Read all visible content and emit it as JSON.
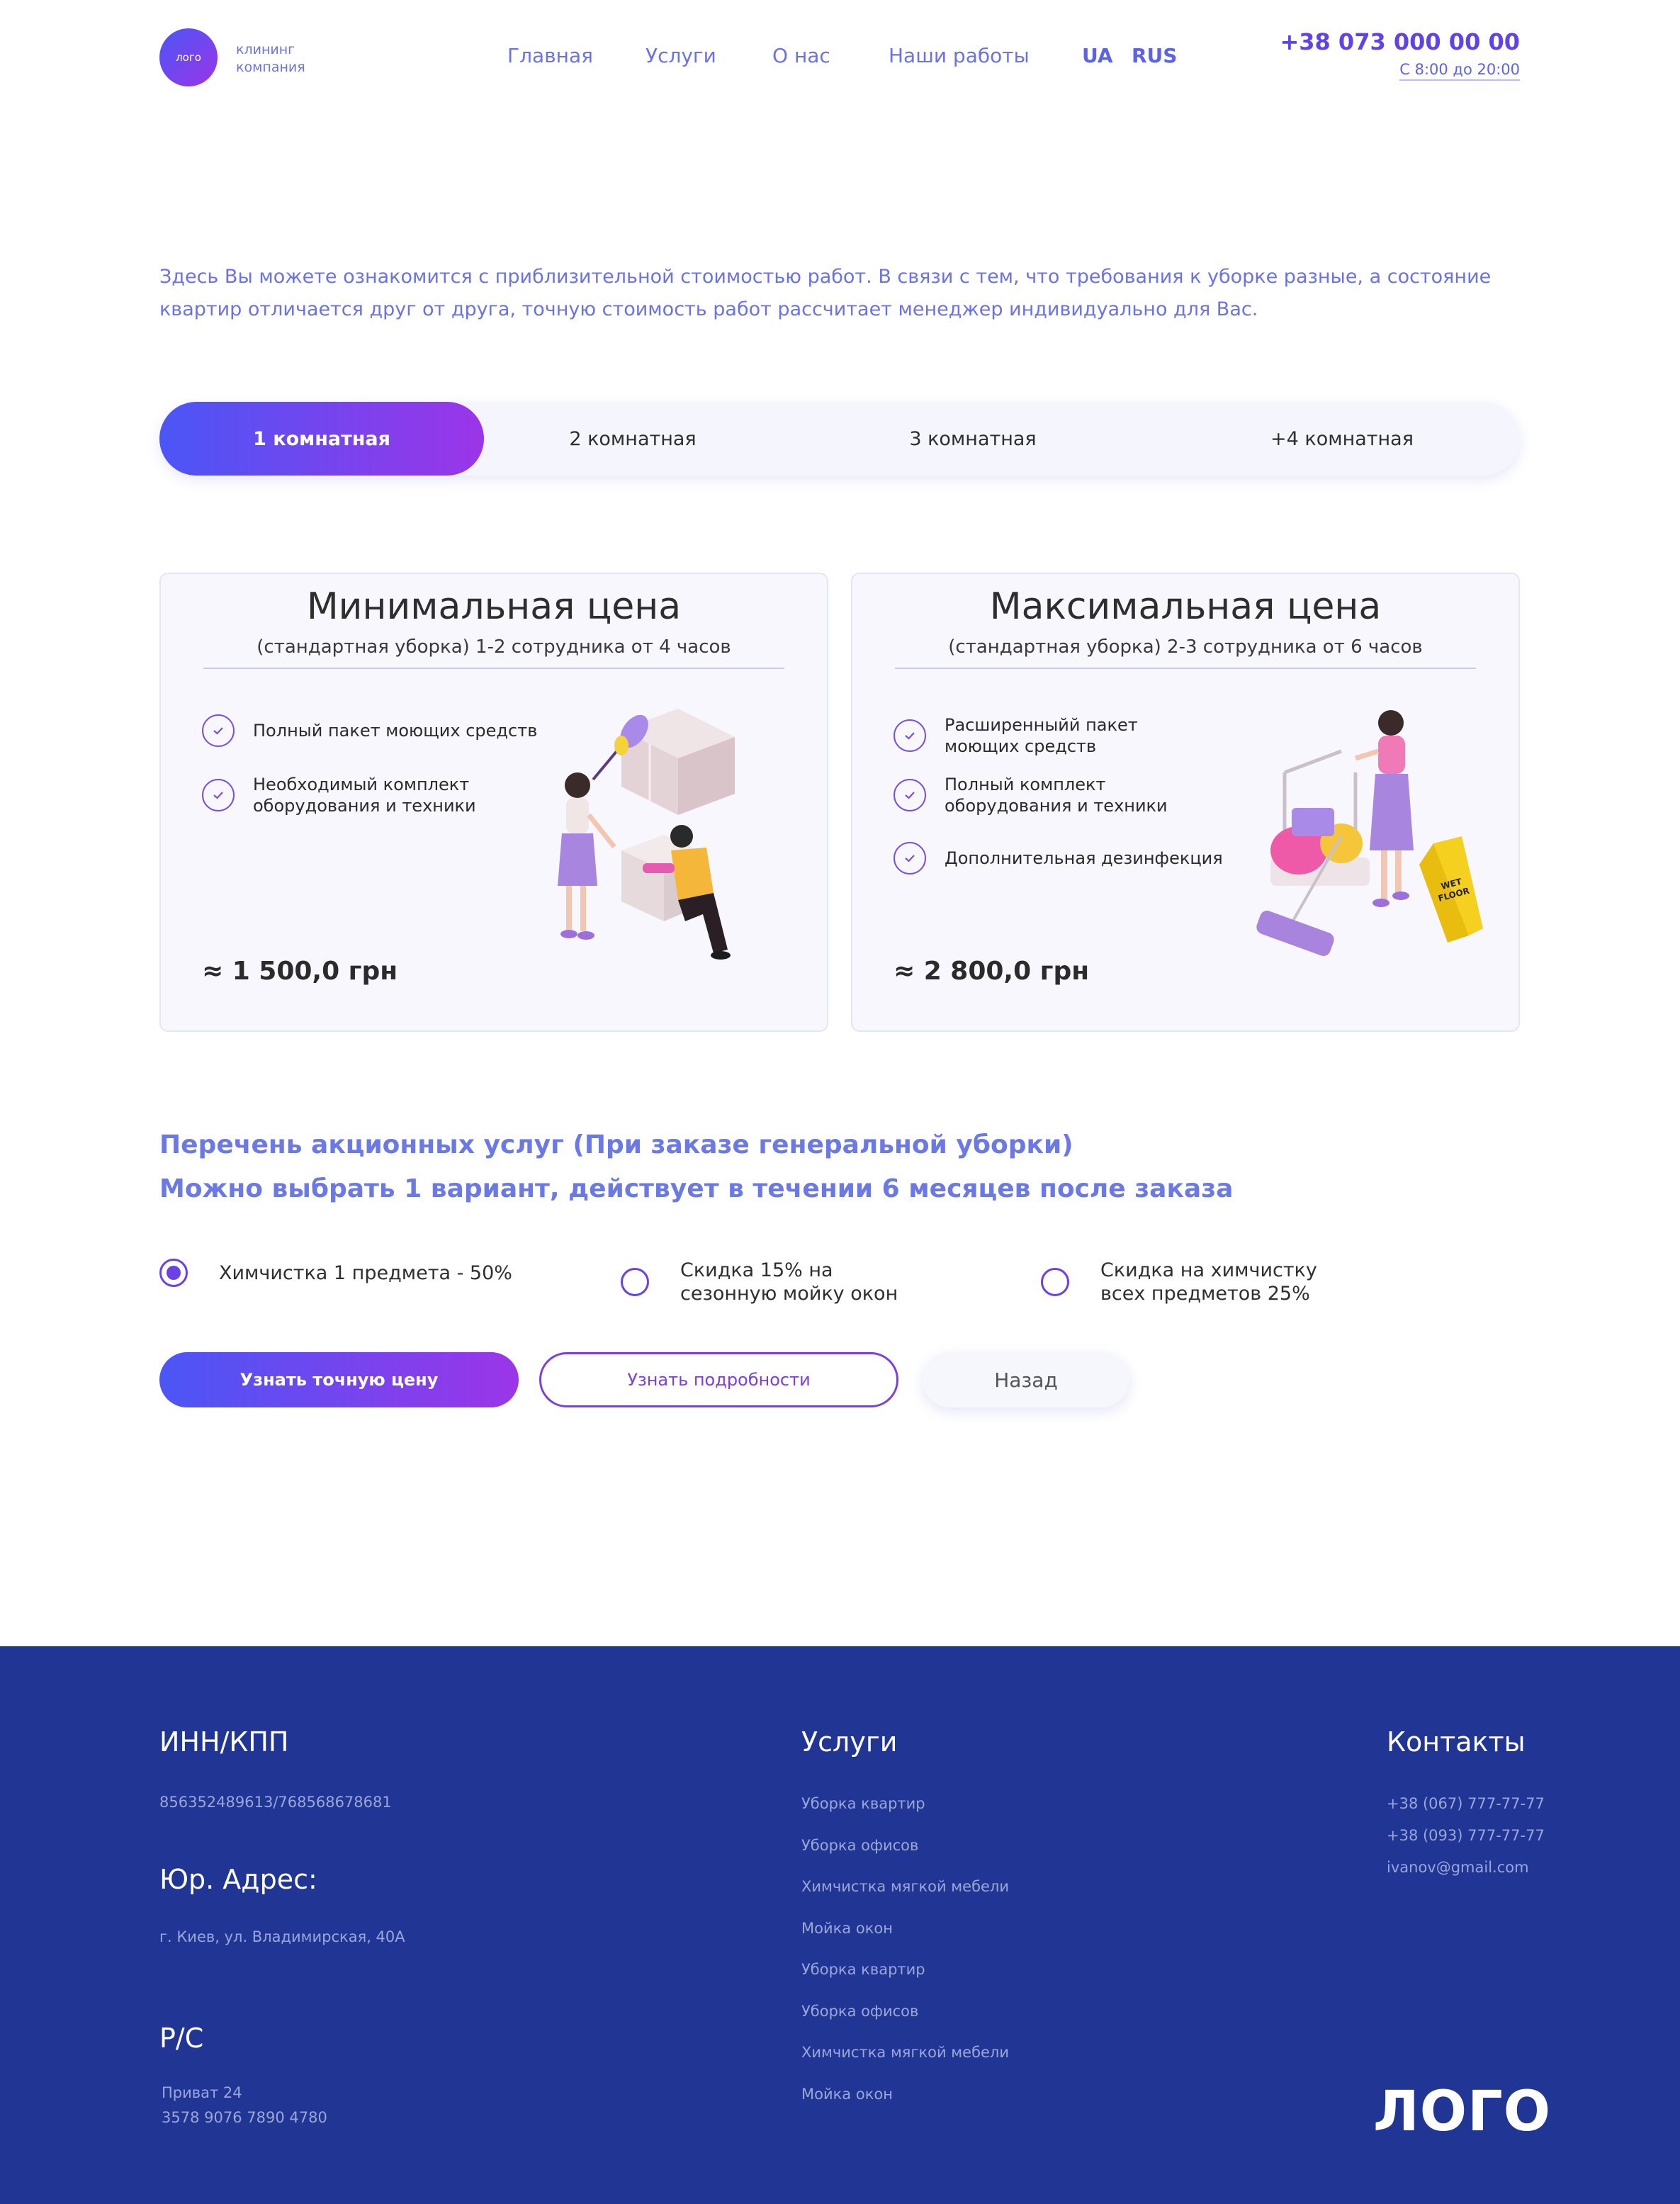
{
  "header": {
    "logo_mark": "лого",
    "logo_caption": "клининг\nкомпания",
    "nav": [
      "Главная",
      "Услуги",
      "О нас",
      "Наши работы"
    ],
    "languages": [
      "UA",
      "RUS"
    ],
    "phone": "+38 073 000 00 00",
    "hours": "С 8:00 до 20:00"
  },
  "intro": "Здесь Вы можете ознакомится с приблизительной стоимостью работ. В связи с тем, что требования к уборке разные, а состояние квартир отличается друг от друга, точную стоимость работ рассчитает менеджер индивидуально для Вас.",
  "tabs": {
    "items": [
      "1 комнатная",
      "2 комнатная",
      "3 комнатная",
      "+4 комнатная"
    ],
    "active_index": 0
  },
  "cards": [
    {
      "title": "Минимальная цена",
      "subtitle": "(стандартная уборка) 1-2 сотрудника от 4 часов",
      "features": [
        "Полный пакет моющих средств",
        "Необходимый комплект\nоборудования и техники"
      ],
      "price": "≈ 1 500,0 грн"
    },
    {
      "title": "Максимальная цена",
      "subtitle": "(стандартная уборка) 2-3 сотрудника от 6 часов",
      "features": [
        "Расширенныйй пакет\nмоющих средств",
        "Полный комплект\nоборудования и техники",
        "Дополнительная дезинфекция"
      ],
      "price": "≈ 2 800,0 грн"
    }
  ],
  "promo": {
    "title_line1": "Перечень акционных услуг (При заказе генеральной уборки)",
    "title_line2": "Можно выбрать 1 вариант, действует в течении 6 месяцев после заказа",
    "options": [
      "Химчистка 1 предмета - 50%",
      "Скидка 15% на\nсезонную мойку окон",
      "Скидка на химчистку\nвсех предметов 25%"
    ],
    "selected_index": 0
  },
  "buttons": {
    "primary": "Узнать точную цену",
    "secondary": "Узнать подробности",
    "back": "Назад"
  },
  "footer": {
    "inn_heading": "ИНН/КПП",
    "inn_value": "856352489613/768568678681",
    "address_heading": "Юр. Адрес:",
    "address_value": "г. Киев, ул. Владимирская, 40А",
    "account_heading": "Р/С",
    "account_bank": "Приват 24",
    "account_number": "3578 9076 7890 4780",
    "services_heading": "Услуги",
    "services": [
      "Уборка квартир",
      "Уборка офисов",
      "Химчистка мягкой мебели",
      "Мойка окон",
      "Уборка квартир",
      "Уборка офисов",
      "Химчистка мягкой мебели",
      "Мойка окон"
    ],
    "contacts_heading": "Контакты",
    "contacts": [
      "+38 (067) 777-77-77",
      "+38 (093) 777-77-77",
      "ivanov@gmail.com"
    ],
    "logo": "ЛОГО"
  },
  "colors": {
    "accent_start": "#4b56f5",
    "accent_end": "#9b35e8",
    "link": "#6a72e6",
    "footer_bg": "#213595"
  },
  "icons": [
    "check-icon",
    "radio-icon"
  ]
}
